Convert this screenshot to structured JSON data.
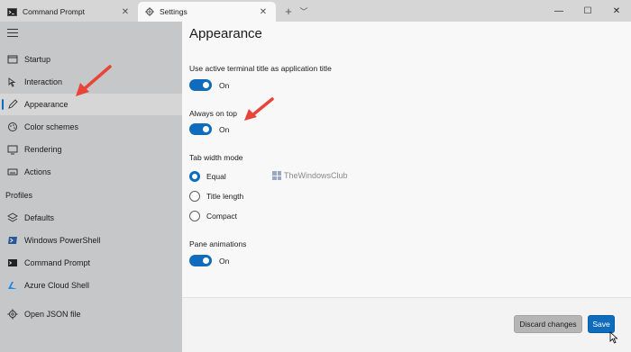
{
  "tabs": [
    {
      "title": "Command Prompt",
      "icon": "cmd-icon"
    },
    {
      "title": "Settings",
      "icon": "gear-icon"
    }
  ],
  "sidebar": {
    "items": [
      {
        "label": "Startup",
        "icon": "startup-icon"
      },
      {
        "label": "Interaction",
        "icon": "interaction-icon"
      },
      {
        "label": "Appearance",
        "icon": "pen-icon",
        "selected": true
      },
      {
        "label": "Color schemes",
        "icon": "palette-icon"
      },
      {
        "label": "Rendering",
        "icon": "monitor-icon"
      },
      {
        "label": "Actions",
        "icon": "keyboard-icon"
      }
    ],
    "profiles_header": "Profiles",
    "profiles": [
      {
        "label": "Defaults",
        "icon": "layers-icon"
      },
      {
        "label": "Windows PowerShell",
        "icon": "powershell-icon"
      },
      {
        "label": "Command Prompt",
        "icon": "cmd-icon"
      },
      {
        "label": "Azure Cloud Shell",
        "icon": "azure-icon"
      }
    ],
    "open_json": "Open JSON file"
  },
  "main": {
    "title": "Appearance",
    "settings": {
      "active_title": {
        "label": "Use active terminal title as application title",
        "state": "On"
      },
      "always_on_top": {
        "label": "Always on top",
        "state": "On"
      },
      "tab_width": {
        "label": "Tab width mode",
        "options": [
          "Equal",
          "Title length",
          "Compact"
        ],
        "selected": "Equal"
      },
      "pane_animations": {
        "label": "Pane animations",
        "state": "On"
      }
    }
  },
  "watermark": "TheWindowsClub",
  "footer": {
    "discard": "Discard changes",
    "save": "Save"
  },
  "colors": {
    "accent": "#0f6cbd",
    "sidebar": "#c6c7c8",
    "arrow": "#e8443a"
  }
}
